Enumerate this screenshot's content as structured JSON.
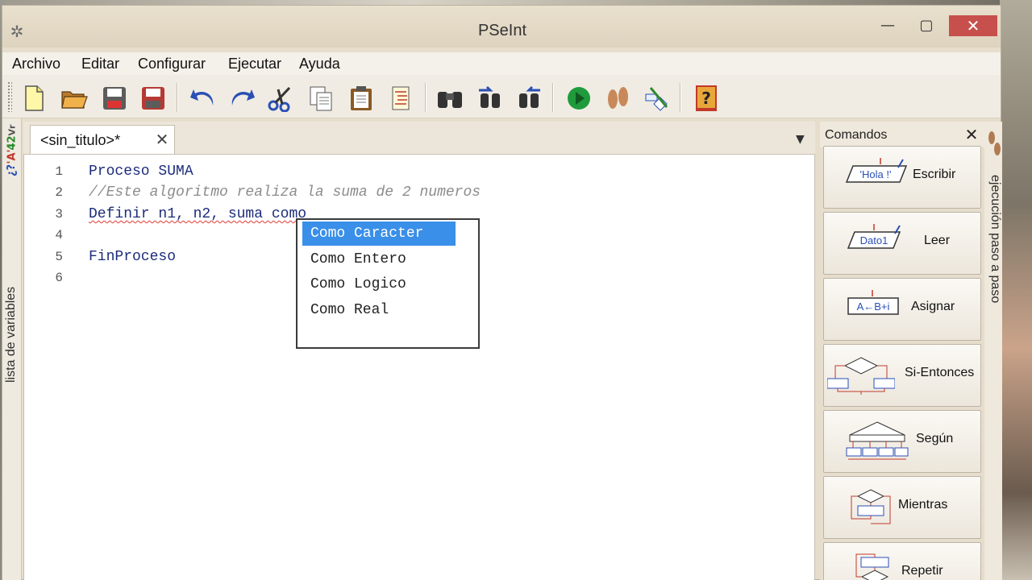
{
  "window": {
    "title": "PSeInt",
    "minimize": "—",
    "maximize": "▢",
    "close": "✕"
  },
  "menu": [
    "Archivo",
    "Editar",
    "Configurar",
    "Ejecutar",
    "Ayuda"
  ],
  "toolbar": {
    "icons": [
      "new-file-icon",
      "open-folder-icon",
      "save-icon",
      "save-as-icon",
      "undo-icon",
      "redo-icon",
      "cut-icon",
      "copy-icon",
      "paste-icon",
      "correct-indent-icon",
      "find-icon",
      "find-previous-icon",
      "find-next-icon",
      "run-icon",
      "step-by-step-icon",
      "draw-flowchart-icon",
      "help-icon"
    ]
  },
  "left_side_tab": {
    "label": "lista de variables",
    "icon_text": [
      "Vr",
      "42",
      "'A'",
      "¿?"
    ]
  },
  "right_side_tab": {
    "label": "ejecución paso a paso"
  },
  "editor": {
    "tab_label": "<sin_titulo>*",
    "tab_close": "✕",
    "tab_menu": "▼",
    "lines": [
      {
        "num": "1",
        "text": "Proceso SUMA",
        "style": "kw"
      },
      {
        "num": "2",
        "text": "//Este algoritmo realiza la suma de 2 numeros",
        "style": "comment"
      },
      {
        "num": "3",
        "text": "Definir n1, n2, suma como",
        "style": "squiggle"
      },
      {
        "num": "4",
        "text": "",
        "style": "plain"
      },
      {
        "num": "5",
        "text": "FinProceso",
        "style": "kw"
      },
      {
        "num": "6",
        "text": "",
        "style": "plain"
      }
    ]
  },
  "autocomplete": {
    "options": [
      "Como Caracter",
      "Como Entero",
      "Como Logico",
      "Como Real"
    ],
    "selected_index": 0
  },
  "commands_panel": {
    "title": "Comandos",
    "close": "✕",
    "items": [
      {
        "label": "Escribir",
        "glyph_text": "'Hola !'"
      },
      {
        "label": "Leer",
        "glyph_text": "Dato1"
      },
      {
        "label": "Asignar",
        "glyph_text": "A←B+i"
      },
      {
        "label": "Si-Entonces",
        "glyph_text": ""
      },
      {
        "label": "Según",
        "glyph_text": ""
      },
      {
        "label": "Mientras",
        "glyph_text": ""
      },
      {
        "label": "Repetir",
        "glyph_text": ""
      }
    ]
  },
  "colors": {
    "selection": "#3a8fe8",
    "keyword": "#1d2c7a",
    "comment": "#8c8c8c",
    "close_button": "#c7504c"
  }
}
